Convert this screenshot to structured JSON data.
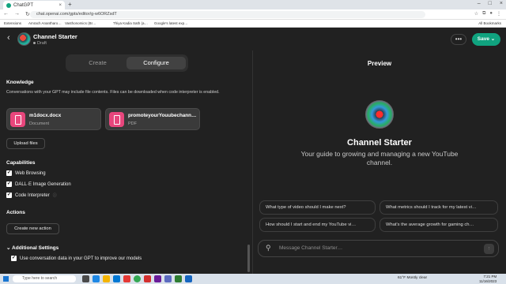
{
  "browser": {
    "tab_title": "ChatGPT",
    "url": "chat.openai.com/gpts/editor/g-w6ORZsdT",
    "bookmarks": [
      "Extensions",
      "Amrach Anantharo…",
      "Vasthonomics (Br…",
      "Thiya Kadia Sath (a…",
      "Google's latest exp…"
    ],
    "all_bookmarks": "All Bookmarks"
  },
  "header": {
    "gpt_name": "Channel Starter",
    "status": "Draft",
    "more_label": "•••",
    "save_label": "Save"
  },
  "config_tabs": {
    "create": "Create",
    "configure": "Configure"
  },
  "knowledge": {
    "title": "Knowledge",
    "description": "Conversations with your GPT may include file contents. Files can be downloaded when code interpreter is enabled.",
    "files": [
      {
        "name": "m1docx.docx",
        "type": "Document"
      },
      {
        "name": "promoteyourYouubechann…",
        "type": "PDF"
      }
    ],
    "upload_label": "Upload files"
  },
  "capabilities": {
    "title": "Capabilities",
    "items": [
      {
        "label": "Web Browsing",
        "checked": true
      },
      {
        "label": "DALL·E Image Generation",
        "checked": true
      },
      {
        "label": "Code Interpreter",
        "checked": true
      }
    ]
  },
  "actions": {
    "title": "Actions",
    "create_label": "Create new action"
  },
  "additional": {
    "title": "Additional Settings",
    "option": "Use conversation data in your GPT to improve our models"
  },
  "preview": {
    "title": "Preview",
    "name": "Channel Starter",
    "description": "Your guide to growing and managing a new YouTube channel.",
    "starters": [
      "What type of video should I make next?",
      "What metrics should I track for my latest vi…",
      "How should I start and end my YouTube vi…",
      "What's the average growth for gaming ch…"
    ],
    "input_placeholder": "Message Channel Starter…"
  },
  "taskbar": {
    "search_placeholder": "Type here to search",
    "weather": "61°F  Mostly clear",
    "time": "7:21 PM",
    "date": "11/16/2023"
  },
  "colors": {
    "accent": "#10a37f",
    "file_icon": "#e8467c",
    "background": "#212121"
  }
}
